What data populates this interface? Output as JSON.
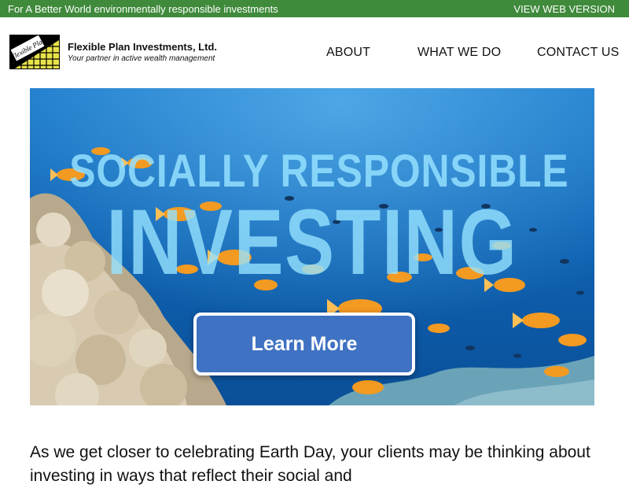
{
  "topbar": {
    "tagline": "For A Better World environmentally responsible investments",
    "web_version": "VIEW WEB VERSION"
  },
  "brand": {
    "logo_text": "Flexible Plan",
    "name": "Flexible Plan Investments, Ltd.",
    "tagline": "Your partner in active wealth management"
  },
  "nav": {
    "about": "ABOUT",
    "what_we_do": "WHAT WE DO",
    "contact": "CONTACT US"
  },
  "hero": {
    "line1": "SOCIALLY RESPONSIBLE",
    "line2": "INVESTING",
    "button": "Learn More"
  },
  "intro": {
    "text": "As we get closer to celebrating Earth Day, your clients may be thinking about investing in ways that reflect their social and"
  },
  "colors": {
    "topbar": "#3f8a3b",
    "button": "#3f72c2",
    "ocean": "#0d5fae"
  }
}
